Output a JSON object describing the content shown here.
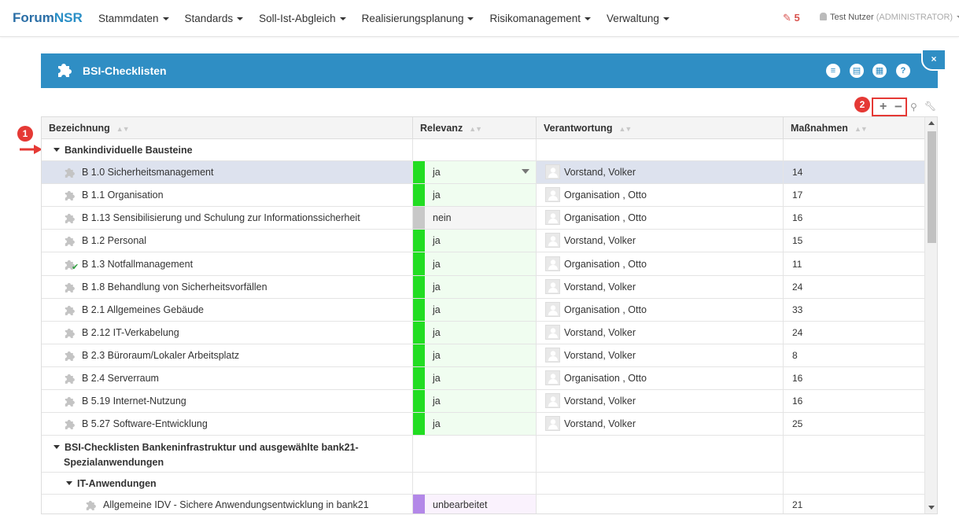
{
  "nav": {
    "brand_a": "Forum",
    "brand_b": "NSR",
    "menu": [
      "Stammdaten",
      "Standards",
      "Soll-Ist-Abgleich",
      "Realisierungsplanung",
      "Risikomanagement",
      "Verwaltung"
    ],
    "edit_count": "5",
    "user_name": "Test Nutzer",
    "user_role": "(ADMINISTRATOR)"
  },
  "panel": {
    "title": "BSI-Checklisten",
    "close": "×",
    "help": "?"
  },
  "callouts": [
    "1",
    "2"
  ],
  "colors": {
    "accent": "#2f8ec4",
    "green": "#22dd22",
    "grey": "#c8c8c8",
    "purple": "#b388e8",
    "callout": "#e53935"
  },
  "columns": [
    "Bezeichnung",
    "Relevanz",
    "Verantwortung",
    "Maßnahmen"
  ],
  "groups": {
    "g1": "Bankindividuelle Bausteine",
    "g2_line1": "BSI-Checklisten Bankeninfrastruktur und ausgewählte bank21-",
    "g2_line2": "Spezialanwendungen",
    "g3": "IT-Anwendungen"
  },
  "rows": [
    {
      "name": "B 1.0 Sicherheitsmanagement",
      "relevanz": "ja",
      "resp": "Vorstand, Volker",
      "count": "14"
    },
    {
      "name": "B 1.1 Organisation",
      "relevanz": "ja",
      "resp": "Organisation , Otto",
      "count": "17"
    },
    {
      "name": "B 1.13 Sensibilisierung und Schulung zur Informationssicherheit",
      "relevanz": "nein",
      "resp": "Organisation , Otto",
      "count": "16"
    },
    {
      "name": "B 1.2 Personal",
      "relevanz": "ja",
      "resp": "Vorstand, Volker",
      "count": "15"
    },
    {
      "name": "B 1.3 Notfallmanagement",
      "relevanz": "ja",
      "resp": "Organisation , Otto",
      "count": "11"
    },
    {
      "name": "B 1.8 Behandlung von Sicherheitsvorfällen",
      "relevanz": "ja",
      "resp": "Vorstand, Volker",
      "count": "24"
    },
    {
      "name": "B 2.1 Allgemeines Gebäude",
      "relevanz": "ja",
      "resp": "Organisation , Otto",
      "count": "33"
    },
    {
      "name": "B 2.12 IT-Verkabelung",
      "relevanz": "ja",
      "resp": "Vorstand, Volker",
      "count": "24"
    },
    {
      "name": "B 2.3 Büroraum/Lokaler Arbeitsplatz",
      "relevanz": "ja",
      "resp": "Vorstand, Volker",
      "count": "8"
    },
    {
      "name": "B 2.4 Serverraum",
      "relevanz": "ja",
      "resp": "Organisation , Otto",
      "count": "16"
    },
    {
      "name": "B 5.19 Internet-Nutzung",
      "relevanz": "ja",
      "resp": "Vorstand, Volker",
      "count": "16"
    },
    {
      "name": "B 5.27 Software-Entwicklung",
      "relevanz": "ja",
      "resp": "Vorstand, Volker",
      "count": "25"
    }
  ],
  "last_row": {
    "name": "Allgemeine IDV - Sichere Anwendungsentwicklung in bank21",
    "relevanz": "unbearbeitet",
    "count": "21"
  }
}
